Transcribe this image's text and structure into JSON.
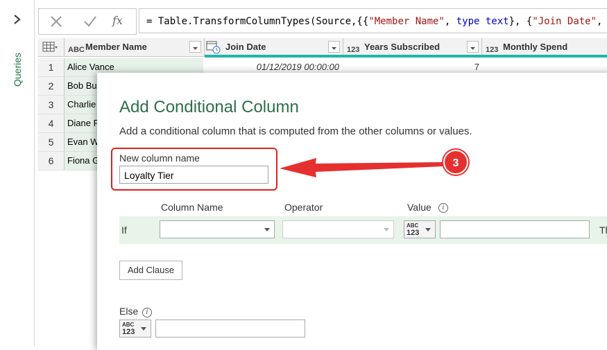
{
  "sidebar": {
    "queries_label": "Queries"
  },
  "formula_bar": {
    "fx_label": "fx",
    "formula_prefix": "= Table.TransformColumnTypes(Source,{{",
    "s1": "\"Member Name\"",
    "c1": ", ",
    "k1": "type text",
    "c2": "}, {",
    "s2": "\"Join Date\"",
    "c3": ", ",
    "k2": "ty"
  },
  "table": {
    "headers": [
      {
        "type_icon": "ABC",
        "label": "Member Name"
      },
      {
        "type_icon": "date",
        "label": "Join Date"
      },
      {
        "type_icon": "123",
        "label": "Years Subscribed"
      },
      {
        "type_icon": "123",
        "label": "Monthly Spend"
      }
    ],
    "rows": [
      {
        "num": "1",
        "name": "Alice Vance",
        "date": "01/12/2019 00:00:00",
        "years": "7"
      },
      {
        "num": "2",
        "name": "Bob Bu",
        "date": "",
        "years": ""
      },
      {
        "num": "3",
        "name": "Charlie",
        "date": "",
        "years": ""
      },
      {
        "num": "4",
        "name": "Diane F",
        "date": "",
        "years": ""
      },
      {
        "num": "5",
        "name": "Evan W",
        "date": "",
        "years": ""
      },
      {
        "num": "6",
        "name": "Fiona G",
        "date": "",
        "years": ""
      }
    ]
  },
  "dialog": {
    "title": "Add Conditional Column",
    "description": "Add a conditional column that is computed from the other columns or values.",
    "new_column_label": "New column name",
    "new_column_value": "Loyalty Tier",
    "col_headers": {
      "column_name": "Column Name",
      "operator": "Operator",
      "value": "Value"
    },
    "if_label": "If",
    "then_label": "Th",
    "type_abc": "ABC",
    "type_123": "123",
    "add_clause_label": "Add Clause",
    "else_label": "Else",
    "info_glyph": "i"
  },
  "annotation": {
    "step_number": "3",
    "color": "#e53030"
  },
  "colors": {
    "accent_green": "#217346",
    "title_green": "#2e6e4a",
    "quality_teal": "#1fb6a8",
    "highlight_red": "#e02020"
  }
}
